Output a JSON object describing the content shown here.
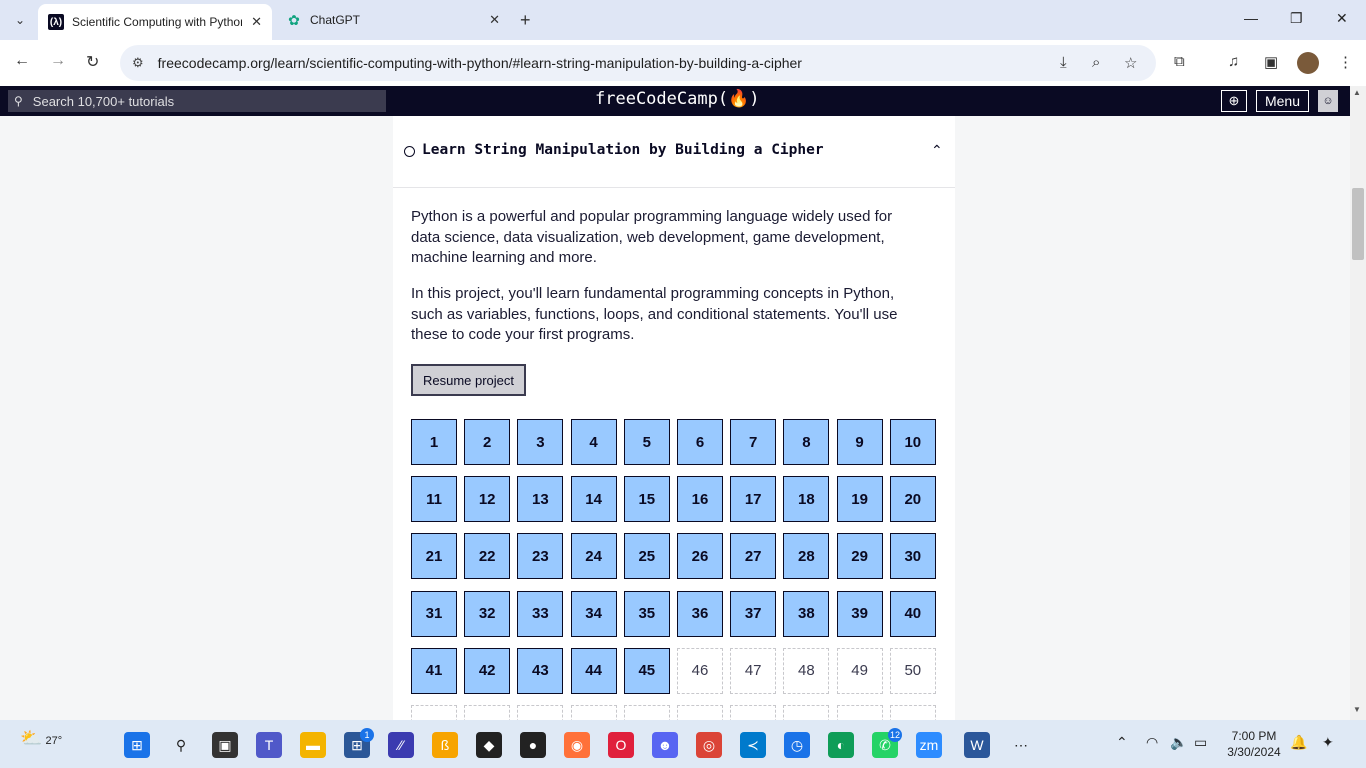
{
  "browser": {
    "tabs": [
      {
        "title": "Scientific Computing with Python",
        "active": true
      },
      {
        "title": "ChatGPT",
        "active": false
      }
    ],
    "url": "freecodecamp.org/learn/scientific-computing-with-python/#learn-string-manipulation-by-building-a-cipher"
  },
  "fcc_nav": {
    "search_placeholder": "Search 10,700+ tutorials",
    "logo": "freeCodeCamp(🔥)",
    "menu_label": "Menu"
  },
  "block": {
    "title": "Learn String Manipulation by Building a Cipher",
    "intro_1": "Python is a powerful and popular programming language widely used for data science, data visualization, web development, game development, machine learning and more.",
    "intro_2": "In this project, you'll learn fundamental programming concepts in Python, such as variables, functions, loops, and conditional statements. You'll use these to code your first programs.",
    "resume_label": "Resume project",
    "steps_completed": 45,
    "steps_visible": [
      1,
      2,
      3,
      4,
      5,
      6,
      7,
      8,
      9,
      10,
      11,
      12,
      13,
      14,
      15,
      16,
      17,
      18,
      19,
      20,
      21,
      22,
      23,
      24,
      25,
      26,
      27,
      28,
      29,
      30,
      31,
      32,
      33,
      34,
      35,
      36,
      37,
      38,
      39,
      40,
      41,
      42,
      43,
      44,
      45,
      46,
      47,
      48,
      49,
      50
    ]
  },
  "taskbar": {
    "weather_temp": "27°",
    "time": "7:00 PM",
    "date": "3/30/2024",
    "badges": {
      "store": "1",
      "whatsapp": "12"
    }
  },
  "colors": {
    "fcc_dark": "#0a0a23",
    "step_done": "#99c9ff",
    "page_bg": "#f5f6f7"
  }
}
